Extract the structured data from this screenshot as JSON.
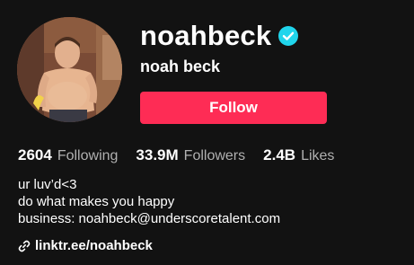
{
  "profile": {
    "username": "noahbeck",
    "nickname": "noah beck",
    "verified": true,
    "follow_label": "Follow",
    "avatar_icon": "avatar-photo"
  },
  "stats": [
    {
      "value": "2604",
      "label": "Following"
    },
    {
      "value": "33.9M",
      "label": "Followers"
    },
    {
      "value": "2.4B",
      "label": "Likes"
    }
  ],
  "bio": {
    "lines": [
      "ur luv’d<3",
      "do what makes you happy",
      "business: noahbeck@underscoretalent.com"
    ]
  },
  "link": {
    "text": "linktr.ee/noahbeck",
    "icon": "link-icon"
  },
  "colors": {
    "background": "#121212",
    "accent": "#fe2c55",
    "verified": "#20d5ec",
    "secondary_text": "#b0b0b0"
  }
}
